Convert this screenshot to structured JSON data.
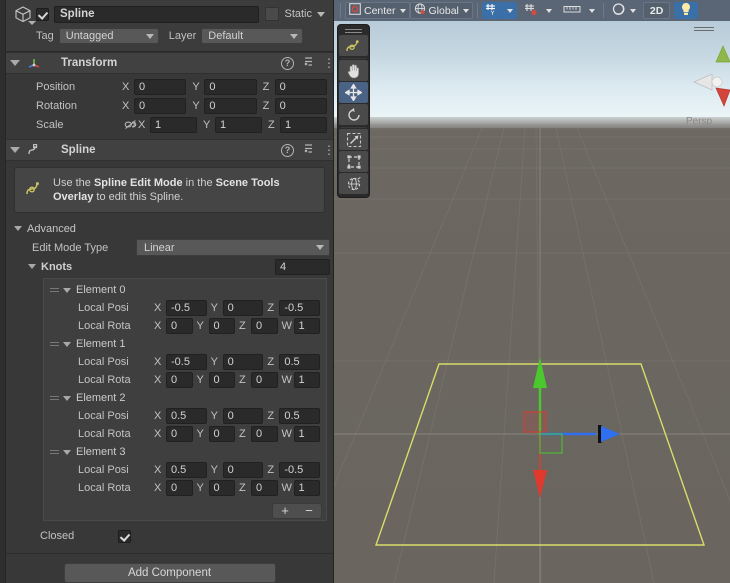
{
  "inspector": {
    "gameobject": {
      "enabled_checkbox": true,
      "name": "Spline",
      "static_label": "Static",
      "tag_label": "Tag",
      "tag_value": "Untagged",
      "layer_label": "Layer",
      "layer_value": "Default"
    },
    "transform": {
      "title": "Transform",
      "rows": [
        {
          "label": "Position",
          "x": "0",
          "y": "0",
          "z": "0"
        },
        {
          "label": "Rotation",
          "x": "0",
          "y": "0",
          "z": "0"
        },
        {
          "label": "Scale",
          "x": "1",
          "y": "1",
          "z": "1"
        }
      ],
      "axis_x": "X",
      "axis_y": "Y",
      "axis_z": "Z"
    },
    "spline": {
      "title": "Spline",
      "info_text_parts": {
        "a": "Use the ",
        "b": "Spline Edit Mode",
        "c": " in the ",
        "d": "Scene Tools Overlay",
        "e": " to edit this Spline."
      },
      "advanced_label": "Advanced",
      "edit_mode_type_label": "Edit Mode Type",
      "edit_mode_type_value": "Linear",
      "knots_label": "Knots",
      "knots_count": "4",
      "pos_label": "Local Posi",
      "rot_label": "Local Rota",
      "axis_x": "X",
      "axis_y": "Y",
      "axis_z": "Z",
      "axis_w": "W",
      "elements": [
        {
          "label": "Element 0",
          "position": {
            "x": "-0.5",
            "y": "0",
            "z": "-0.5"
          },
          "rotation": {
            "x": "0",
            "y": "0",
            "z": "0",
            "w": "1"
          }
        },
        {
          "label": "Element 1",
          "position": {
            "x": "-0.5",
            "y": "0",
            "z": "0.5"
          },
          "rotation": {
            "x": "0",
            "y": "0",
            "z": "0",
            "w": "1"
          }
        },
        {
          "label": "Element 2",
          "position": {
            "x": "0.5",
            "y": "0",
            "z": "0.5"
          },
          "rotation": {
            "x": "0",
            "y": "0",
            "z": "0",
            "w": "1"
          }
        },
        {
          "label": "Element 3",
          "position": {
            "x": "0.5",
            "y": "0",
            "z": "-0.5"
          },
          "rotation": {
            "x": "0",
            "y": "0",
            "z": "0",
            "w": "1"
          }
        }
      ],
      "add_element_label": "+",
      "remove_element_label": "−",
      "closed_label": "Closed",
      "closed_checked": true
    },
    "add_component_label": "Add Component"
  },
  "scene": {
    "toolbar": {
      "pivot_mode": "Center",
      "handle_space": "Global",
      "grid_snap_label": "",
      "two_d_label": "2D",
      "items": [
        "center-pivot-dropdown",
        "global-handle-dropdown",
        "grid-axis-dropdown",
        "snap-increment-dropdown",
        "grid-visibility-dropdown",
        "gizmos-dropdown",
        "2d-toggle",
        "scene-lighting-toggle"
      ]
    },
    "tools_overlay": {
      "tools": [
        {
          "name": "spline-tool",
          "selected": false
        },
        {
          "name": "hand-tool",
          "selected": false
        },
        {
          "name": "move-tool",
          "selected": true
        },
        {
          "name": "rotate-tool",
          "selected": false
        },
        {
          "name": "scale-tool",
          "selected": false
        },
        {
          "name": "rect-tool",
          "selected": false
        },
        {
          "name": "transform-tool",
          "selected": false
        }
      ]
    },
    "view_gizmo": {
      "projection_label": "Persp"
    },
    "spline_color": "#d8dd6a",
    "gizmo": {
      "axis_y_color": "#4ac82e",
      "axis_z_color": "#e03a2f",
      "axis_x_color": "#2f6ff0"
    }
  }
}
